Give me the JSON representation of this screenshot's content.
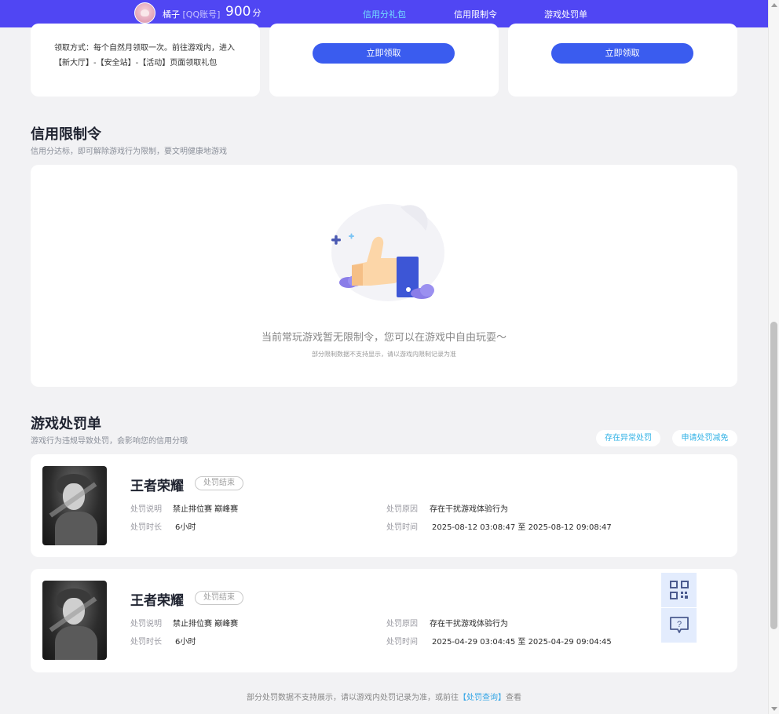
{
  "header": {
    "username": "橘子",
    "account_type": "[QQ账号]",
    "score": "900",
    "score_unit": "分",
    "tabs": [
      {
        "label": "信用分礼包",
        "active": true
      },
      {
        "label": "信用限制令",
        "active": false
      },
      {
        "label": "游戏处罚单",
        "active": false
      }
    ]
  },
  "gift": {
    "description": "领取方式：每个自然月领取一次。前往游戏内，进入【新大厅】-【安全站】-【活动】页面领取礼包",
    "claim_label": "立即领取"
  },
  "restriction": {
    "title": "信用限制令",
    "subtitle": "信用分达标，即可解除游戏行为限制，要文明健康地游戏",
    "empty_message": "当前常玩游戏暂无限制令，您可以在游戏中自由玩耍～",
    "empty_note": "部分限制数据不支持显示，请以游戏内限制记录为准"
  },
  "penalty": {
    "title": "游戏处罚单",
    "subtitle": "游戏行为违规导致处罚，会影响您的信用分哦",
    "abnormal_button": "存在异常处罚",
    "reduce_button": "申请处罚减免",
    "labels": {
      "desc": "处罚说明",
      "duration": "处罚时长",
      "reason": "处罚原因",
      "time": "处罚时间"
    },
    "items": [
      {
        "game": "王者荣耀",
        "status": "处罚结束",
        "desc": "禁止排位赛 巅峰赛",
        "duration": "6小时",
        "reason": "存在干扰游戏体验行为",
        "time": "2025-08-12 03:08:47 至 2025-08-12 09:08:47"
      },
      {
        "game": "王者荣耀",
        "status": "处罚结束",
        "desc": "禁止排位赛 巅峰赛",
        "duration": "6小时",
        "reason": "存在干扰游戏体验行为",
        "time": "2025-04-29 03:04:45 至 2025-04-29 09:04:45"
      }
    ]
  },
  "footer": {
    "note_before": "部分处罚数据不支持展示，请以游戏内处罚记录为准，或前往",
    "link": "【处罚查询】",
    "note_after": "查看"
  },
  "colors": {
    "header_bg": "#5046f3",
    "accent": "#3a5cef",
    "active_tab": "#74e0ff",
    "link": "#35a6e6"
  }
}
